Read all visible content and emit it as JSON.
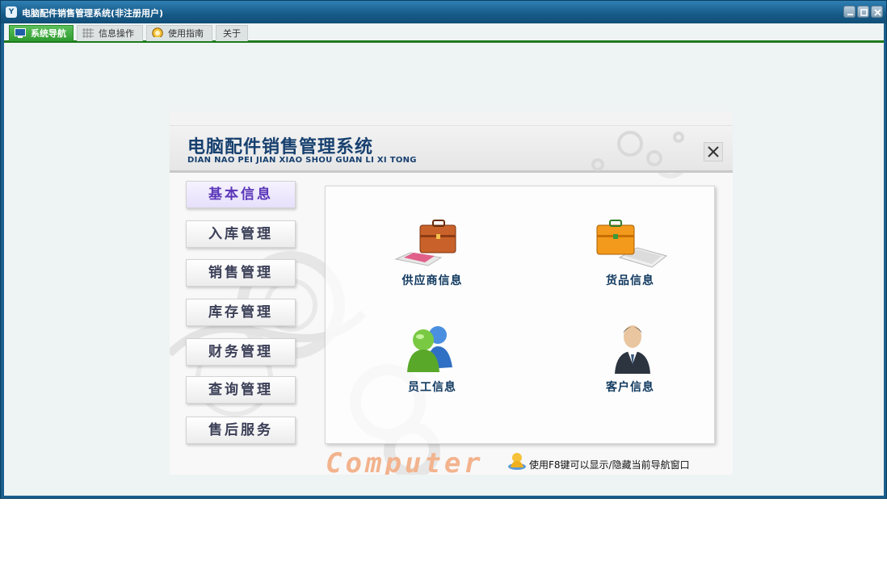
{
  "window": {
    "title": "电脑配件销售管理系统(非注册用户)",
    "icon": "app-logo-icon"
  },
  "tabs": [
    {
      "label": "系统导航",
      "icon": "monitor-icon",
      "active": true
    },
    {
      "label": "信息操作",
      "icon": "grid-icon",
      "active": false
    },
    {
      "label": "使用指南",
      "icon": "help-icon",
      "active": false
    },
    {
      "label": "关于",
      "icon": "",
      "active": false
    }
  ],
  "panel": {
    "title": "电脑配件销售管理系统",
    "subtitle": "DIAN NAO PEI JIAN XIAO SHOU GUAN LI XI TONG",
    "side_buttons": [
      "基本信息",
      "入库管理",
      "销售管理",
      "库存管理",
      "财务管理",
      "查询管理",
      "售后服务"
    ],
    "active_side_button": "基本信息",
    "tiles": [
      {
        "label": "供应商信息",
        "icon": "briefcase-brown-icon"
      },
      {
        "label": "货品信息",
        "icon": "briefcase-orange-icon"
      },
      {
        "label": "员工信息",
        "icon": "users-icon"
      },
      {
        "label": "客户信息",
        "icon": "businessman-icon"
      }
    ],
    "footer_brand": "Computer",
    "footer_hint": "使用F8键可以显示/隐藏当前导航窗口"
  },
  "colors": {
    "titlebar": "#175a87",
    "tab_active": "#2e9a2e",
    "panel_title": "#17406f",
    "active_button_text": "#5a36b8"
  }
}
